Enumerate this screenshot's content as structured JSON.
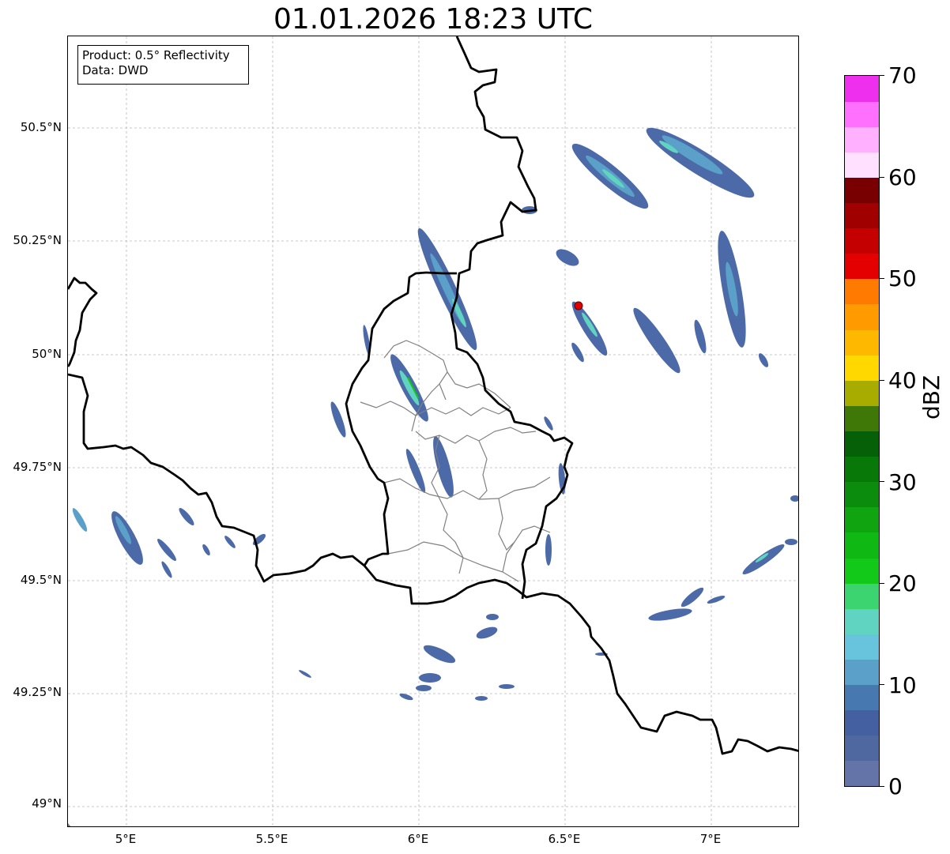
{
  "title": "01.01.2026 18:23 UTC",
  "info": {
    "product": "Product: 0.5° Reflectivity",
    "data": "Data: DWD"
  },
  "lat_ticks": [
    "50.5°N",
    "50.25°N",
    "50°N",
    "49.75°N",
    "49.5°N",
    "49.25°N",
    "49°N"
  ],
  "lon_ticks": [
    "5°E",
    "5.5°E",
    "6°E",
    "6.5°E",
    "7°E"
  ],
  "colorbar": {
    "label": "dBZ",
    "tick_labels": [
      "0",
      "10",
      "20",
      "30",
      "40",
      "50",
      "60",
      "70"
    ],
    "colors": [
      "#6474a8",
      "#5068a0",
      "#4460a0",
      "#4878b0",
      "#5aa0c8",
      "#68c4dc",
      "#60d4c0",
      "#3cd470",
      "#12c818",
      "#10b814",
      "#10a410",
      "#0c8c0c",
      "#087808",
      "#066008",
      "#407808",
      "#a8ac00",
      "#ffd800",
      "#ffb800",
      "#ff9a00",
      "#ff7a00",
      "#e40000",
      "#c40000",
      "#a00000",
      "#780000",
      "#ffe0ff",
      "#ffb0ff",
      "#ff70ff",
      "#ee30ee"
    ],
    "colors_note": "28 steps of 2.5 dBZ from 0 to 70"
  },
  "radar_site": {
    "lon": 6.55,
    "lat": 50.11,
    "color": "#e00000"
  },
  "map_extent": {
    "lon": [
      4.8,
      7.3
    ],
    "lat": [
      48.95,
      50.7
    ]
  }
}
